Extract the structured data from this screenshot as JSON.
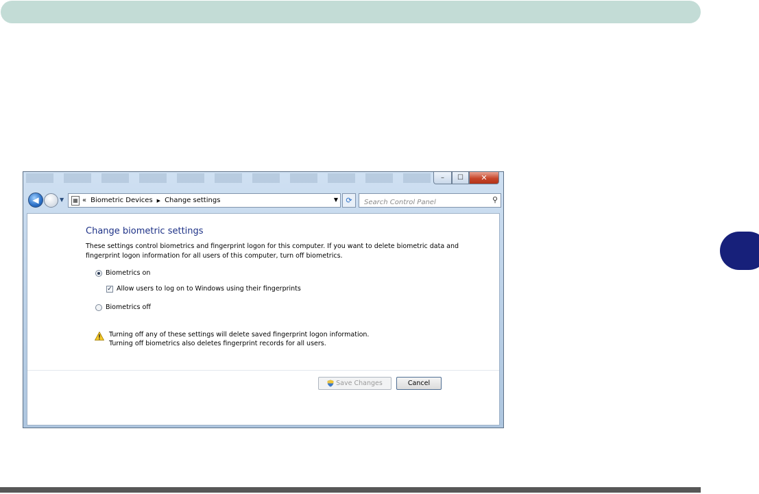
{
  "window": {
    "address": {
      "chevron": "«",
      "crumb1": "Biometric Devices",
      "crumb2": "Change settings"
    },
    "search": {
      "placeholder": "Search Control Panel"
    },
    "caption": {
      "min": "–",
      "max": "☐",
      "close": "✕"
    }
  },
  "content": {
    "title": "Change biometric settings",
    "description": "These settings control biometrics and fingerprint logon for this computer. If you want to delete biometric data and fingerprint logon information for all users of this computer, turn off biometrics.",
    "option_on": "Biometrics on",
    "option_allow": "Allow users to log on to Windows using their fingerprints",
    "option_off": "Biometrics off",
    "warning_line1": "Turning off any of these settings will delete saved fingerprint logon information.",
    "warning_line2": "Turning off biometrics also deletes fingerprint records for all users.",
    "save_label": "Save Changes",
    "cancel_label": "Cancel"
  },
  "icons": {
    "back": "back-arrow-icon",
    "forward": "forward-arrow-icon",
    "search": "search-icon",
    "refresh": "refresh-icon",
    "warning": "warning-icon",
    "shield": "uac-shield-icon"
  },
  "colors": {
    "title": "#1e3287",
    "top_bar": "#c3dcd6",
    "side_tab": "#17207a",
    "bottom_bar": "#575757"
  }
}
